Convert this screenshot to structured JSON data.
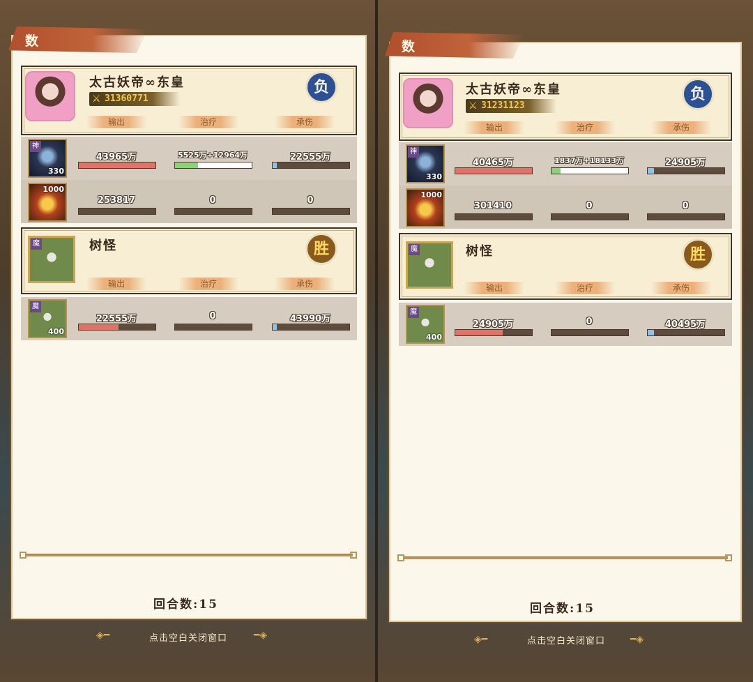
{
  "panels": [
    {
      "title": "数据统计",
      "hero": {
        "name": "太古妖帝∞东皇",
        "power": "31360771",
        "result": "负"
      },
      "col_tags": [
        "输出",
        "治疗",
        "承伤"
      ],
      "units": [
        {
          "level": "330",
          "damage": "43965万",
          "damage_pct": 1.0,
          "heal": "5525万+12964万",
          "heal_pct": 0.3,
          "taken": "22555万",
          "taken_pct": 0.05
        },
        {
          "level": "1000",
          "damage": "253817",
          "damage_pct": 0.0,
          "heal": "0",
          "heal_pct": 0.0,
          "taken": "0",
          "taken_pct": 0.0
        }
      ],
      "enemy": {
        "name": "树怪",
        "result": "胜",
        "tag": "魔"
      },
      "enemy_units": [
        {
          "level": "400",
          "tag": "魔",
          "damage": "22555万",
          "damage_pct": 0.52,
          "heal": "0",
          "heal_pct": 0.0,
          "taken": "43990万",
          "taken_pct": 0.05
        }
      ],
      "rounds": "回合数:15",
      "close_hint": "点击空白关闭窗口"
    },
    {
      "title": "数据统计",
      "hero": {
        "name": "太古妖帝∞东皇",
        "power": "31231123",
        "result": "负"
      },
      "col_tags": [
        "输出",
        "治疗",
        "承伤"
      ],
      "units": [
        {
          "level": "330",
          "damage": "40465万",
          "damage_pct": 1.0,
          "heal": "1837万+18133万",
          "heal_pct": 0.12,
          "taken": "24905万",
          "taken_pct": 0.08
        },
        {
          "level": "1000",
          "damage": "301410",
          "damage_pct": 0.0,
          "heal": "0",
          "heal_pct": 0.0,
          "taken": "0",
          "taken_pct": 0.0
        }
      ],
      "enemy": {
        "name": "树怪",
        "result": "胜",
        "tag": "魔"
      },
      "enemy_units": [
        {
          "level": "400",
          "tag": "魔",
          "damage": "24905万",
          "damage_pct": 0.62,
          "heal": "0",
          "heal_pct": 0.0,
          "taken": "40495万",
          "taken_pct": 0.08
        }
      ],
      "rounds": "回合数:15",
      "close_hint": "点击空白关闭窗口"
    }
  ],
  "unit_tag": "神",
  "colors": {
    "lose_badge": "#2d4f93",
    "win_badge": "#8a5a1c",
    "damage_bar": "#e07268",
    "heal_bar": "#8fd07a",
    "taken_bar": "#8ec3ea"
  }
}
